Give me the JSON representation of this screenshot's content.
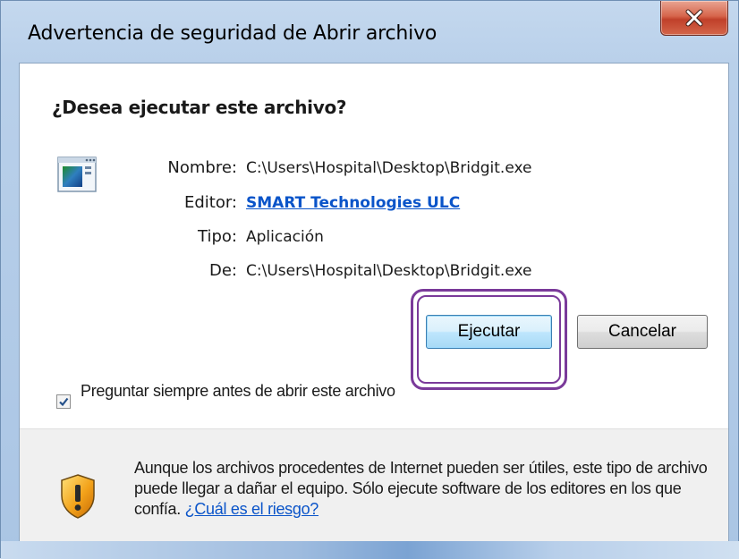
{
  "window": {
    "title": "Advertencia de seguridad de Abrir archivo",
    "close_icon": "close-icon"
  },
  "dialog": {
    "question": "¿Desea ejecutar este archivo?",
    "file_icon": "application-icon",
    "fields": {
      "name_label": "Nombre:",
      "name_value": "C:\\Users\\Hospital\\Desktop\\Bridgit.exe",
      "publisher_label": "Editor:",
      "publisher_value": "SMART Technologies ULC",
      "type_label": "Tipo:",
      "type_value": "Aplicación",
      "from_label": "De:",
      "from_value": "C:\\Users\\Hospital\\Desktop\\Bridgit.exe"
    },
    "buttons": {
      "run": "Ejecutar",
      "cancel": "Cancelar"
    },
    "checkbox": {
      "label": "Preguntar siempre antes de abrir este archivo",
      "checked": true
    }
  },
  "footer": {
    "shield_icon": "warning-shield-icon",
    "warning_text": "Aunque los archivos procedentes de Internet pueden ser útiles, este tipo de archivo puede llegar a dañar el equipo. Sólo ejecute software de los editores en los que confía.",
    "risk_link": "¿Cuál es el riesgo?"
  },
  "colors": {
    "link": "#0a54c9",
    "highlight_ring": "#7a3a9a",
    "close_button": "#c0402a"
  }
}
